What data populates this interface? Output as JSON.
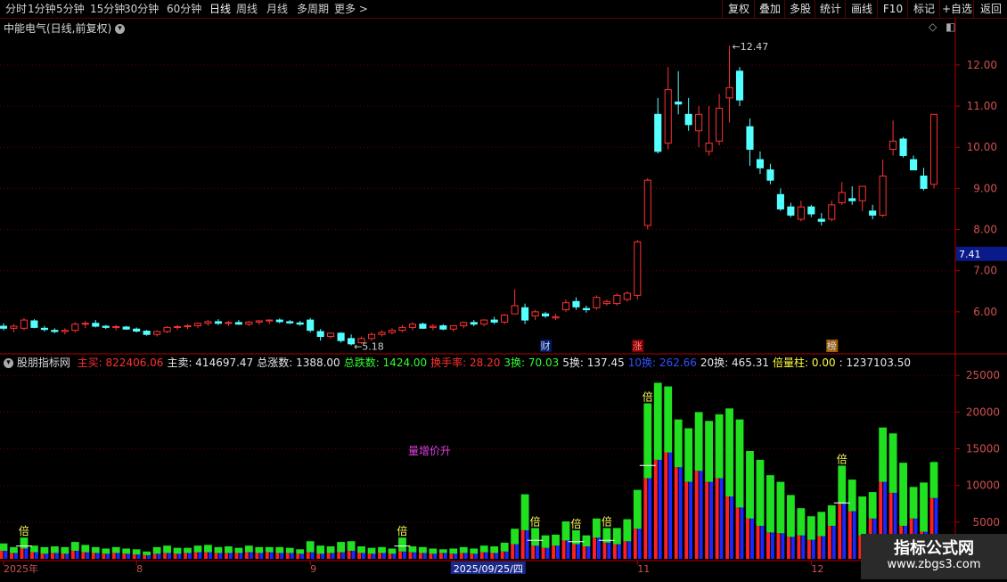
{
  "toolbar": {
    "periods": [
      "分时",
      "1分钟",
      "5分钟",
      "15分钟",
      "30分钟",
      "60分钟",
      "日线",
      "周线",
      "月线",
      "多周期",
      "更多 >"
    ],
    "active_period": "日线",
    "right_buttons": [
      "复权",
      "叠加",
      "多股",
      "统计",
      "画线",
      "F10",
      "标记",
      "+自选",
      "返回"
    ]
  },
  "price_panel": {
    "title": "中能电气(日线,前复权)",
    "high_label": "12.47",
    "low_label": "5.18",
    "current_price_tag": "7.41",
    "events": [
      {
        "label": "财",
        "index": 53
      },
      {
        "label": "涨",
        "index": 62
      },
      {
        "label": "榜",
        "index": 81
      }
    ]
  },
  "volume_panel": {
    "indicator_name": "股朋指标网",
    "stats": [
      {
        "label": "主买:",
        "value": "822406.06",
        "color": "#ff3030"
      },
      {
        "label": "主卖:",
        "value": "414697.47",
        "color": "#e8e8e8"
      },
      {
        "label": "总涨数:",
        "value": "1388.00",
        "color": "#e8e8e8"
      },
      {
        "label": "总跌数:",
        "value": "1424.00",
        "color": "#30ff30"
      },
      {
        "label": "换手率:",
        "value": "28.20",
        "color": "#ff3030"
      },
      {
        "label": "3换:",
        "value": "70.03",
        "color": "#30ff30"
      },
      {
        "label": "5换:",
        "value": "137.45",
        "color": "#e8e8e8"
      },
      {
        "label": "10换:",
        "value": "262.66",
        "color": "#3050ff"
      },
      {
        "label": "20换:",
        "value": "465.31",
        "color": "#e8e8e8"
      },
      {
        "label": "倍量柱:",
        "value": "0.00",
        "color": "#ffff40"
      },
      {
        "label": ":",
        "value": "1237103.50",
        "color": "#e8e8e8"
      }
    ],
    "annotation": "量增价升",
    "bei_marker": "倍",
    "bei_indices": [
      2,
      39,
      52,
      56,
      59,
      63,
      82
    ]
  },
  "x_axis_labels": [
    {
      "label": "2025年",
      "index": 0
    },
    {
      "label": "8",
      "index": 13
    },
    {
      "label": "9",
      "index": 30
    },
    {
      "label": "2025/09/25/四",
      "index": 44,
      "highlight": true
    },
    {
      "label": "11",
      "index": 62
    },
    {
      "label": "12",
      "index": 79
    }
  ],
  "watermark": {
    "line1": "指标公式网",
    "line2": "www.zbgs3.com"
  },
  "colors": {
    "up": "#ff3232",
    "down": "#54ffff",
    "axis": "#b00000",
    "grid": "#5a0000",
    "bg": "#000000"
  },
  "chart_data": [
    {
      "type": "candlestick",
      "title": "中能电气(日线,前复权)",
      "ylim": [
        5.0,
        12.8
      ],
      "yticks": [
        6.0,
        7.0,
        8.0,
        9.0,
        10.0,
        11.0,
        12.0
      ],
      "ohlc": [
        [
          5.65,
          5.72,
          5.55,
          5.6
        ],
        [
          5.6,
          5.7,
          5.5,
          5.65
        ],
        [
          5.6,
          5.85,
          5.55,
          5.8
        ],
        [
          5.78,
          5.82,
          5.6,
          5.62
        ],
        [
          5.6,
          5.66,
          5.52,
          5.57
        ],
        [
          5.55,
          5.6,
          5.48,
          5.52
        ],
        [
          5.52,
          5.6,
          5.45,
          5.55
        ],
        [
          5.55,
          5.75,
          5.5,
          5.7
        ],
        [
          5.7,
          5.78,
          5.6,
          5.72
        ],
        [
          5.72,
          5.8,
          5.62,
          5.65
        ],
        [
          5.65,
          5.68,
          5.58,
          5.62
        ],
        [
          5.62,
          5.68,
          5.55,
          5.64
        ],
        [
          5.63,
          5.66,
          5.56,
          5.58
        ],
        [
          5.58,
          5.62,
          5.5,
          5.53
        ],
        [
          5.53,
          5.56,
          5.42,
          5.45
        ],
        [
          5.45,
          5.55,
          5.4,
          5.52
        ],
        [
          5.52,
          5.65,
          5.48,
          5.62
        ],
        [
          5.62,
          5.68,
          5.56,
          5.64
        ],
        [
          5.64,
          5.7,
          5.58,
          5.66
        ],
        [
          5.66,
          5.74,
          5.6,
          5.72
        ],
        [
          5.72,
          5.8,
          5.66,
          5.76
        ],
        [
          5.76,
          5.82,
          5.68,
          5.72
        ],
        [
          5.72,
          5.78,
          5.65,
          5.74
        ],
        [
          5.74,
          5.8,
          5.68,
          5.7
        ],
        [
          5.7,
          5.78,
          5.65,
          5.75
        ],
        [
          5.75,
          5.8,
          5.68,
          5.78
        ],
        [
          5.78,
          5.82,
          5.7,
          5.8
        ],
        [
          5.8,
          5.84,
          5.72,
          5.76
        ],
        [
          5.76,
          5.8,
          5.7,
          5.73
        ],
        [
          5.73,
          5.78,
          5.66,
          5.7
        ],
        [
          5.8,
          5.85,
          5.5,
          5.55
        ],
        [
          5.52,
          5.58,
          5.3,
          5.4
        ],
        [
          5.4,
          5.5,
          5.35,
          5.48
        ],
        [
          5.48,
          5.5,
          5.25,
          5.3
        ],
        [
          5.35,
          5.45,
          5.18,
          5.22
        ],
        [
          5.25,
          5.4,
          5.22,
          5.35
        ],
        [
          5.35,
          5.5,
          5.3,
          5.45
        ],
        [
          5.45,
          5.55,
          5.4,
          5.5
        ],
        [
          5.5,
          5.6,
          5.45,
          5.55
        ],
        [
          5.55,
          5.68,
          5.5,
          5.62
        ],
        [
          5.62,
          5.75,
          5.55,
          5.7
        ],
        [
          5.7,
          5.74,
          5.58,
          5.6
        ],
        [
          5.62,
          5.7,
          5.55,
          5.65
        ],
        [
          5.66,
          5.7,
          5.55,
          5.58
        ],
        [
          5.58,
          5.68,
          5.52,
          5.66
        ],
        [
          5.66,
          5.76,
          5.6,
          5.74
        ],
        [
          5.74,
          5.8,
          5.65,
          5.7
        ],
        [
          5.7,
          5.82,
          5.65,
          5.8
        ],
        [
          5.8,
          5.88,
          5.7,
          5.75
        ],
        [
          5.75,
          5.95,
          5.7,
          5.92
        ],
        [
          5.95,
          6.55,
          5.95,
          6.15
        ],
        [
          6.1,
          6.2,
          5.7,
          5.8
        ],
        [
          5.9,
          6.05,
          5.8,
          6.0
        ],
        [
          5.95,
          6.0,
          5.85,
          5.9
        ],
        [
          5.85,
          5.95,
          5.8,
          5.88
        ],
        [
          6.05,
          6.3,
          6.0,
          6.22
        ],
        [
          6.25,
          6.35,
          6.05,
          6.12
        ],
        [
          6.08,
          6.15,
          5.98,
          6.05
        ],
        [
          6.1,
          6.4,
          6.05,
          6.35
        ],
        [
          6.2,
          6.3,
          6.15,
          6.25
        ],
        [
          6.2,
          6.45,
          6.15,
          6.4
        ],
        [
          6.3,
          6.5,
          6.25,
          6.45
        ],
        [
          6.4,
          7.75,
          6.3,
          7.7
        ],
        [
          8.1,
          9.25,
          8.0,
          9.2
        ],
        [
          10.8,
          11.2,
          9.85,
          9.9
        ],
        [
          10.1,
          11.95,
          9.95,
          11.4
        ],
        [
          11.1,
          11.85,
          10.8,
          11.05
        ],
        [
          10.8,
          11.2,
          10.4,
          10.55
        ],
        [
          10.4,
          11.0,
          10.0,
          10.8
        ],
        [
          9.9,
          11.0,
          9.8,
          10.1
        ],
        [
          10.15,
          11.3,
          10.05,
          10.95
        ],
        [
          11.2,
          12.47,
          10.6,
          11.45
        ],
        [
          11.85,
          11.95,
          11.0,
          11.15
        ],
        [
          10.5,
          10.7,
          9.55,
          9.95
        ],
        [
          9.7,
          9.9,
          9.35,
          9.5
        ],
        [
          9.45,
          9.6,
          9.1,
          9.2
        ],
        [
          8.85,
          9.0,
          8.45,
          8.5
        ],
        [
          8.55,
          8.65,
          8.3,
          8.35
        ],
        [
          8.25,
          8.7,
          8.2,
          8.55
        ],
        [
          8.55,
          8.6,
          8.3,
          8.38
        ],
        [
          8.25,
          8.4,
          8.1,
          8.2
        ],
        [
          8.25,
          8.7,
          8.2,
          8.6
        ],
        [
          8.65,
          9.15,
          8.6,
          8.9
        ],
        [
          8.75,
          9.05,
          8.6,
          8.7
        ],
        [
          8.7,
          9.0,
          8.45,
          9.05
        ],
        [
          8.45,
          8.6,
          8.25,
          8.35
        ],
        [
          8.35,
          9.7,
          8.3,
          9.3
        ],
        [
          9.95,
          10.65,
          9.8,
          10.15
        ],
        [
          10.2,
          10.25,
          9.75,
          9.8
        ],
        [
          9.7,
          9.8,
          9.45,
          9.45
        ],
        [
          9.3,
          9.5,
          8.95,
          9.0
        ],
        [
          9.1,
          10.8,
          9.0,
          10.8
        ]
      ]
    },
    {
      "type": "bar",
      "title": "股朋指标网",
      "ylim": [
        0,
        26000
      ],
      "yticks": [
        5000,
        10000,
        15000,
        20000,
        25000
      ],
      "series_names": [
        "red",
        "blue",
        "green"
      ],
      "volume": [
        [
          1100,
          400,
          600
        ],
        [
          800,
          300,
          500
        ],
        [
          1400,
          300,
          1200
        ],
        [
          900,
          400,
          500
        ],
        [
          700,
          300,
          600
        ],
        [
          800,
          500,
          400
        ],
        [
          700,
          400,
          500
        ],
        [
          1100,
          300,
          900
        ],
        [
          900,
          300,
          700
        ],
        [
          800,
          400,
          400
        ],
        [
          700,
          300,
          400
        ],
        [
          800,
          300,
          500
        ],
        [
          700,
          400,
          300
        ],
        [
          600,
          300,
          400
        ],
        [
          500,
          200,
          300
        ],
        [
          700,
          200,
          700
        ],
        [
          800,
          300,
          700
        ],
        [
          700,
          300,
          500
        ],
        [
          800,
          300,
          400
        ],
        [
          900,
          400,
          500
        ],
        [
          900,
          400,
          600
        ],
        [
          800,
          500,
          300
        ],
        [
          800,
          300,
          600
        ],
        [
          800,
          400,
          300
        ],
        [
          900,
          400,
          500
        ],
        [
          800,
          400,
          400
        ],
        [
          900,
          400,
          300
        ],
        [
          800,
          500,
          300
        ],
        [
          800,
          400,
          300
        ],
        [
          700,
          300,
          300
        ],
        [
          900,
          1100,
          400
        ],
        [
          700,
          800,
          300
        ],
        [
          800,
          600,
          300
        ],
        [
          900,
          900,
          500
        ],
        [
          1100,
          800,
          500
        ],
        [
          800,
          400,
          500
        ],
        [
          700,
          300,
          500
        ],
        [
          800,
          400,
          400
        ],
        [
          700,
          400,
          300
        ],
        [
          1000,
          300,
          1600
        ],
        [
          900,
          400,
          400
        ],
        [
          800,
          500,
          300
        ],
        [
          700,
          300,
          400
        ],
        [
          800,
          300,
          200
        ],
        [
          700,
          300,
          400
        ],
        [
          800,
          300,
          500
        ],
        [
          700,
          300,
          400
        ],
        [
          900,
          300,
          600
        ],
        [
          800,
          400,
          500
        ],
        [
          1000,
          300,
          900
        ],
        [
          2000,
          600,
          1500
        ],
        [
          3900,
          1500,
          3400
        ],
        [
          1800,
          900,
          1500
        ],
        [
          1500,
          800,
          900
        ],
        [
          1800,
          700,
          800
        ],
        [
          2500,
          1100,
          1500
        ],
        [
          2000,
          900,
          1000
        ],
        [
          1700,
          800,
          700
        ],
        [
          2900,
          1100,
          1500
        ],
        [
          2200,
          1200,
          800
        ],
        [
          2000,
          1400,
          800
        ],
        [
          2400,
          1600,
          1400
        ],
        [
          4100,
          2700,
          2600
        ],
        [
          11000,
          2700,
          7500
        ],
        [
          13500,
          3000,
          7500
        ],
        [
          14500,
          4000,
          5000
        ],
        [
          12500,
          3500,
          3000
        ],
        [
          10500,
          4800,
          2500
        ],
        [
          12000,
          3500,
          4500
        ],
        [
          10500,
          6000,
          2300
        ],
        [
          11000,
          5500,
          3200
        ],
        [
          8500,
          9000,
          3000
        ],
        [
          7000,
          8000,
          4000
        ],
        [
          5500,
          8000,
          1200
        ],
        [
          4500,
          8000,
          1000
        ],
        [
          3600,
          7000,
          800
        ],
        [
          3500,
          6500,
          500
        ],
        [
          3000,
          5000,
          700
        ],
        [
          3200,
          500,
          3200
        ],
        [
          2600,
          1900,
          1300
        ],
        [
          3100,
          1500,
          1800
        ],
        [
          4500,
          800,
          2000
        ],
        [
          7500,
          700,
          4500
        ],
        [
          6500,
          800,
          3500
        ],
        [
          3200,
          4000,
          1300
        ],
        [
          5500,
          1600,
          2000
        ],
        [
          10500,
          1400,
          6000
        ],
        [
          9000,
          2100,
          6000
        ],
        [
          4500,
          8300,
          300
        ],
        [
          5500,
          4000,
          300
        ],
        [
          3700,
          6300,
          400
        ],
        [
          8300,
          1000,
          3900
        ]
      ]
    }
  ]
}
